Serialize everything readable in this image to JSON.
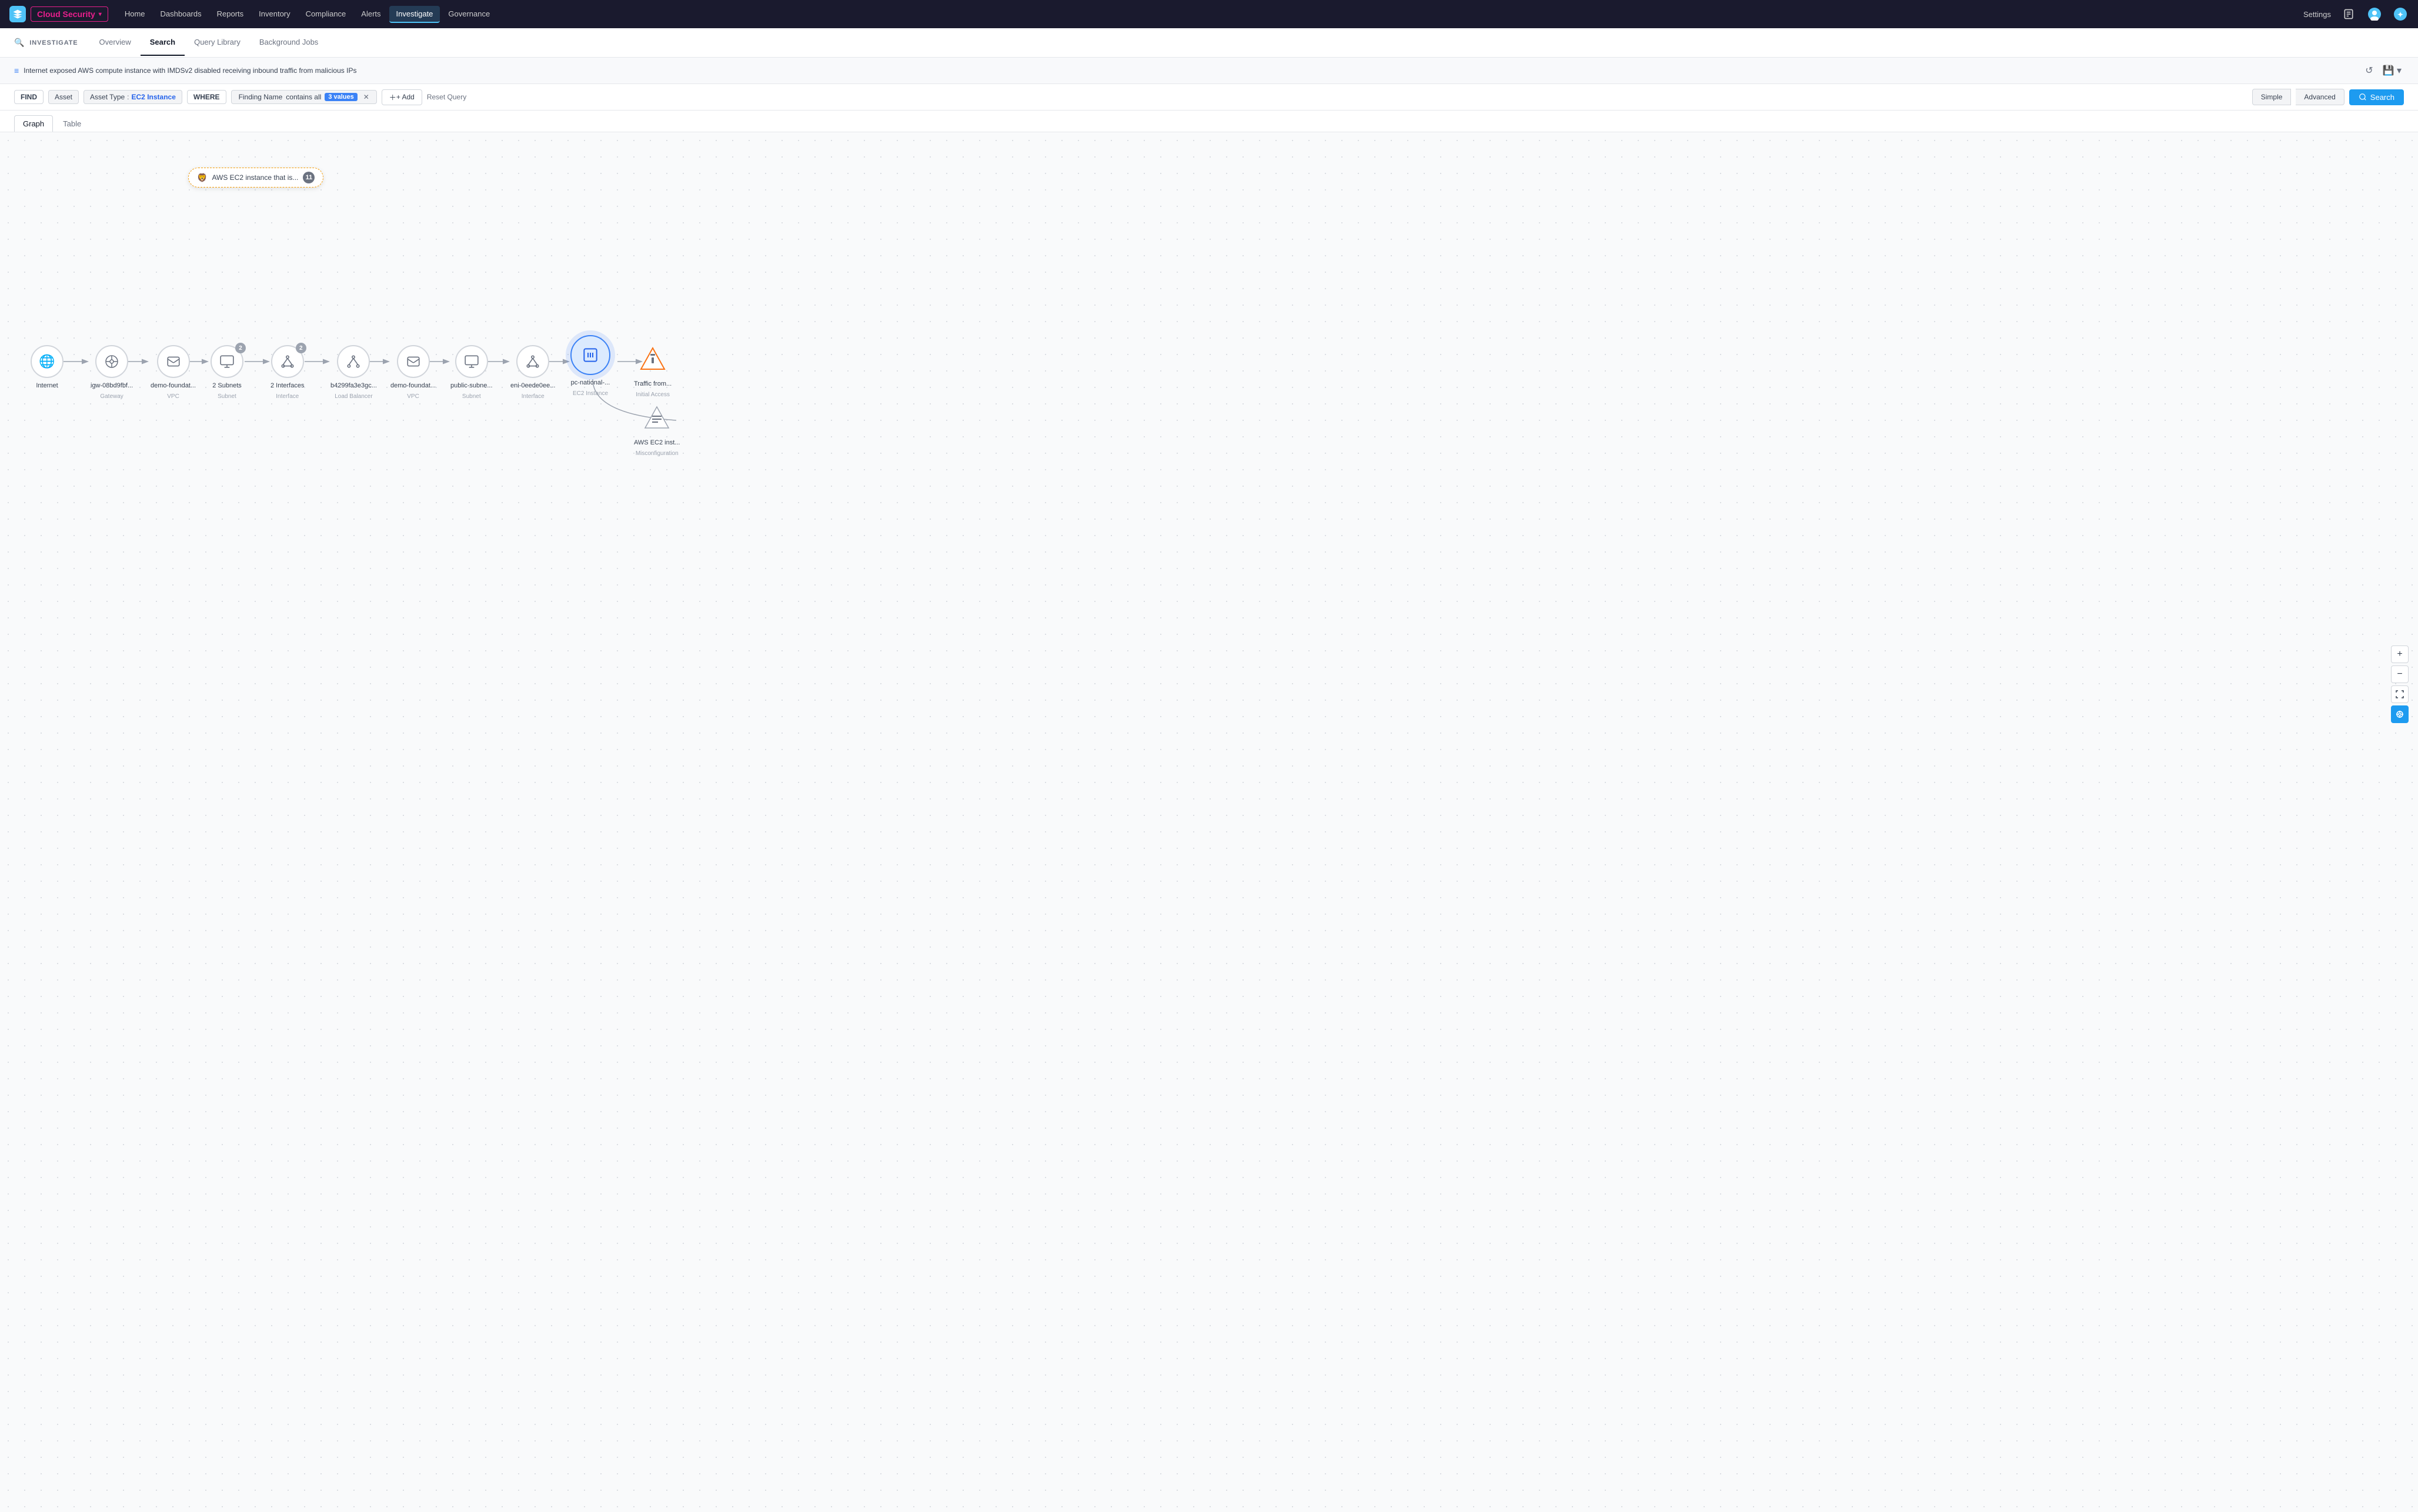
{
  "topnav": {
    "product": "Cloud Security",
    "links": [
      "Home",
      "Dashboards",
      "Reports",
      "Inventory",
      "Compliance",
      "Alerts",
      "Investigate",
      "Governance"
    ],
    "active_link": "Investigate",
    "settings": "Settings"
  },
  "investigate": {
    "label": "INVESTIGATE",
    "tabs": [
      "Overview",
      "Search",
      "Query Library",
      "Background Jobs"
    ],
    "active_tab": "Search"
  },
  "description": {
    "text": "Internet exposed AWS compute instance with IMDSv2 disabled receiving inbound traffic from malicious IPs"
  },
  "query": {
    "find_label": "FIND",
    "asset_label": "Asset",
    "asset_type_label": "Asset Type",
    "asset_type_colon": ":",
    "asset_type_value": "EC2 Instance",
    "where_label": "WHERE",
    "condition_field": "Finding Name",
    "condition_op": "contains all",
    "condition_val": "3 values",
    "add_label": "+ Add",
    "reset_label": "Reset Query",
    "simple_label": "Simple",
    "advanced_label": "Advanced",
    "search_label": "Search"
  },
  "view_tabs": {
    "tabs": [
      "Graph",
      "Table"
    ],
    "active": "Graph"
  },
  "graph": {
    "tooltip": {
      "icon": "🦁",
      "text": "AWS EC2 instance that is...",
      "count": "11"
    },
    "nodes": [
      {
        "id": "internet",
        "icon": "🌐",
        "label": "Internet",
        "sublabel": "",
        "badge": null,
        "type": "normal"
      },
      {
        "id": "igw",
        "icon": "⊕",
        "label": "igw-08bd9fbf...",
        "sublabel": "Gateway",
        "badge": null,
        "type": "normal"
      },
      {
        "id": "vpc1",
        "icon": "☁",
        "label": "demo-foundat...",
        "sublabel": "VPC",
        "badge": null,
        "type": "normal"
      },
      {
        "id": "subnets",
        "icon": "⊗",
        "label": "2 Subnets",
        "sublabel": "Subnet",
        "badge": "2",
        "type": "normal"
      },
      {
        "id": "interfaces",
        "icon": "⊙",
        "label": "2 Interfaces",
        "sublabel": "Interface",
        "badge": "2",
        "type": "normal"
      },
      {
        "id": "lb",
        "icon": "⊛",
        "label": "b4299fa3e3gc...",
        "sublabel": "Load Balancer",
        "badge": null,
        "type": "normal"
      },
      {
        "id": "vpc2",
        "icon": "☁",
        "label": "demo-foundat...",
        "sublabel": "VPC",
        "badge": null,
        "type": "normal"
      },
      {
        "id": "subnet2",
        "icon": "⊗",
        "label": "public-subne...",
        "sublabel": "Subnet",
        "badge": null,
        "type": "normal"
      },
      {
        "id": "eni",
        "icon": "⊙",
        "label": "eni-0eede0ee...",
        "sublabel": "Interface",
        "badge": null,
        "type": "normal"
      },
      {
        "id": "ec2",
        "icon": "⚙",
        "label": "pc-national-...",
        "sublabel": "EC2 Instance",
        "badge": null,
        "type": "selected"
      },
      {
        "id": "finding",
        "icon": "▲",
        "label": "Traffic from...",
        "sublabel": "Initial Access",
        "badge": null,
        "type": "finding"
      }
    ],
    "misc_node": {
      "icon": "≡",
      "label": "AWS EC2 inst...",
      "sublabel": "Misconfiguration"
    }
  },
  "zoom_controls": {
    "plus": "+",
    "minus": "−",
    "fit": "⛶",
    "target": "◎"
  }
}
